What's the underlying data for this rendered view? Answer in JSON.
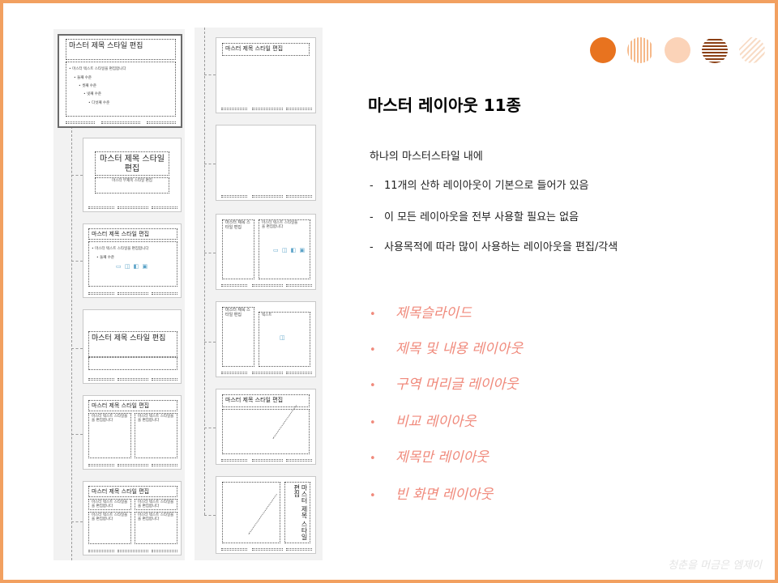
{
  "slide": {
    "title": "마스터 레이아웃 11종",
    "intro": "하나의 마스터스타일 내에",
    "dash_items": [
      "11개의 산하 레이아웃이 기본으로 들어가 있음",
      "이 모든 레이아웃을 전부 사용할 필요는 없음",
      "사용목적에 따라 많이 사용하는 레이아웃을 편집/각색"
    ],
    "dash_symbol": "-",
    "bullet_symbol": "•",
    "layouts": [
      "제목슬라이드",
      "제목 및 내용 레이아웃",
      "구역 머리글 레이아웃",
      "비교 레이아웃",
      "제목만 레이아웃",
      "빈 화면 레이아웃"
    ],
    "footer": "청춘을 머금은 엠제이"
  },
  "colors": {
    "border": "#f2a060",
    "bullet": "#f08a7c",
    "circle_solid": "#e8731f",
    "circle_stripe": "#f6b98a",
    "circle_light": "#fbd3b8",
    "circle_dark_stripe": "#8a3f14",
    "circle_faint_stripe": "#f8dcc6"
  },
  "thumbnails": {
    "master_title": "마스터 제목 스타일 편집",
    "master_text": "• 마스터 텍스트 스타일을 편집합니다",
    "level2": "• 둘째 수준",
    "level3": "• 셋째 수준",
    "level4": "• 넷째 수준",
    "level5": "• 다섯째 수준",
    "subtitle_text": "마스터 부제목 스타일 편집",
    "title_wrap": "마스터 제목 스타일 편집",
    "title_short": "마스터 제목 스\n타일 편집",
    "text_short": "마스터 텍스트 스타일을\n을 편집합니다",
    "text_label": "텍스트",
    "icons": "▭ ◫ ◧ ▣",
    "vertical_title": "마스터 제목 스타일 편집",
    "vertical_text": "마스터 텍스트 스타일을 편집합니다"
  },
  "icons": {
    "circle1": "solid-circle-icon",
    "circle2": "striped-circle-icon",
    "circle3": "light-circle-icon",
    "circle4": "dark-striped-circle-icon",
    "circle5": "faint-diagonal-circle-icon"
  }
}
